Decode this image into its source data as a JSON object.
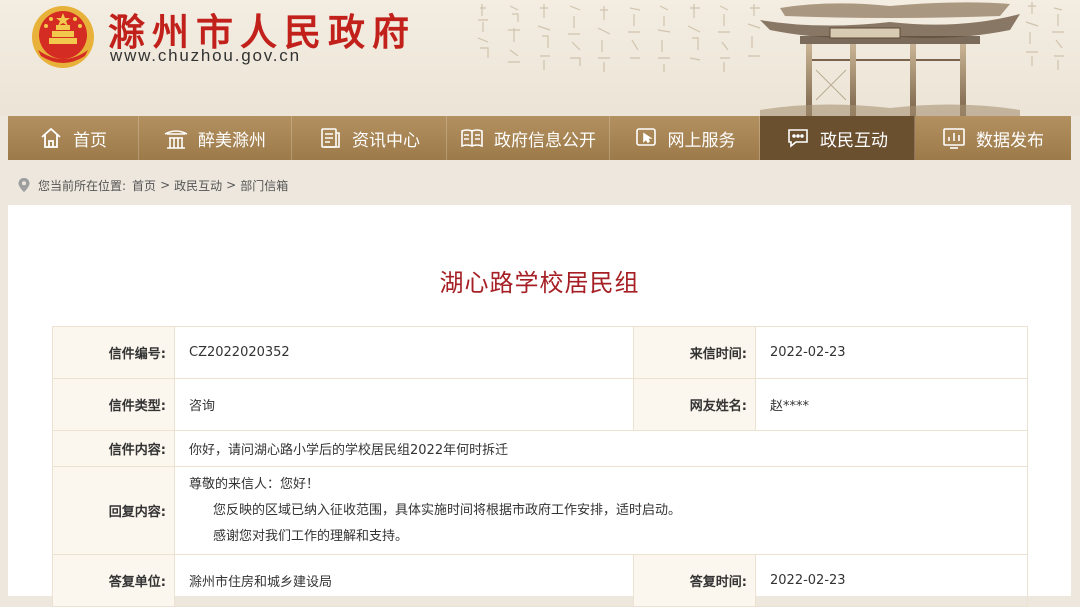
{
  "header": {
    "site_title": "滁州市人民政府",
    "site_url": "www.chuzhou.gov.cn",
    "colors": {
      "title": "#c1201b",
      "nav_bg": "#a98656",
      "nav_active": "#6b5030",
      "page_title": "#a51f24"
    }
  },
  "nav": {
    "items": [
      {
        "label": "首页",
        "icon": "home-icon"
      },
      {
        "label": "醉美滁州",
        "icon": "pavilion-icon"
      },
      {
        "label": "资讯中心",
        "icon": "news-icon"
      },
      {
        "label": "政府信息公开",
        "icon": "book-icon"
      },
      {
        "label": "网上服务",
        "icon": "cursor-icon"
      },
      {
        "label": "政民互动",
        "icon": "chat-icon",
        "active": true
      },
      {
        "label": "数据发布",
        "icon": "bar-chart-icon"
      }
    ]
  },
  "breadcrumb": {
    "prefix": "您当前所在位置:",
    "items": [
      "首页",
      "政民互动",
      "部门信箱"
    ],
    "separator": ">"
  },
  "letter": {
    "title": "湖心路学校居民组",
    "number_label": "信件编号:",
    "number": "CZ2022020352",
    "received_label": "来信时间:",
    "received": "2022-02-23",
    "type_label": "信件类型:",
    "type": "咨询",
    "sender_label": "网友姓名:",
    "sender": "赵****",
    "content_label": "信件内容:",
    "content": "你好，请问湖心路小学后的学校居民组2022年何时拆迁",
    "reply_label": "回复内容:",
    "reply_lines": [
      "尊敬的来信人：您好！",
      "您反映的区域已纳入征收范围，具体实施时间将根据市政府工作安排，适时启动。",
      "感谢您对我们工作的理解和支持。"
    ],
    "unit_label": "答复单位:",
    "unit": "滁州市住房和城乡建设局",
    "reply_time_label": "答复时间:",
    "reply_time": "2022-02-23"
  }
}
